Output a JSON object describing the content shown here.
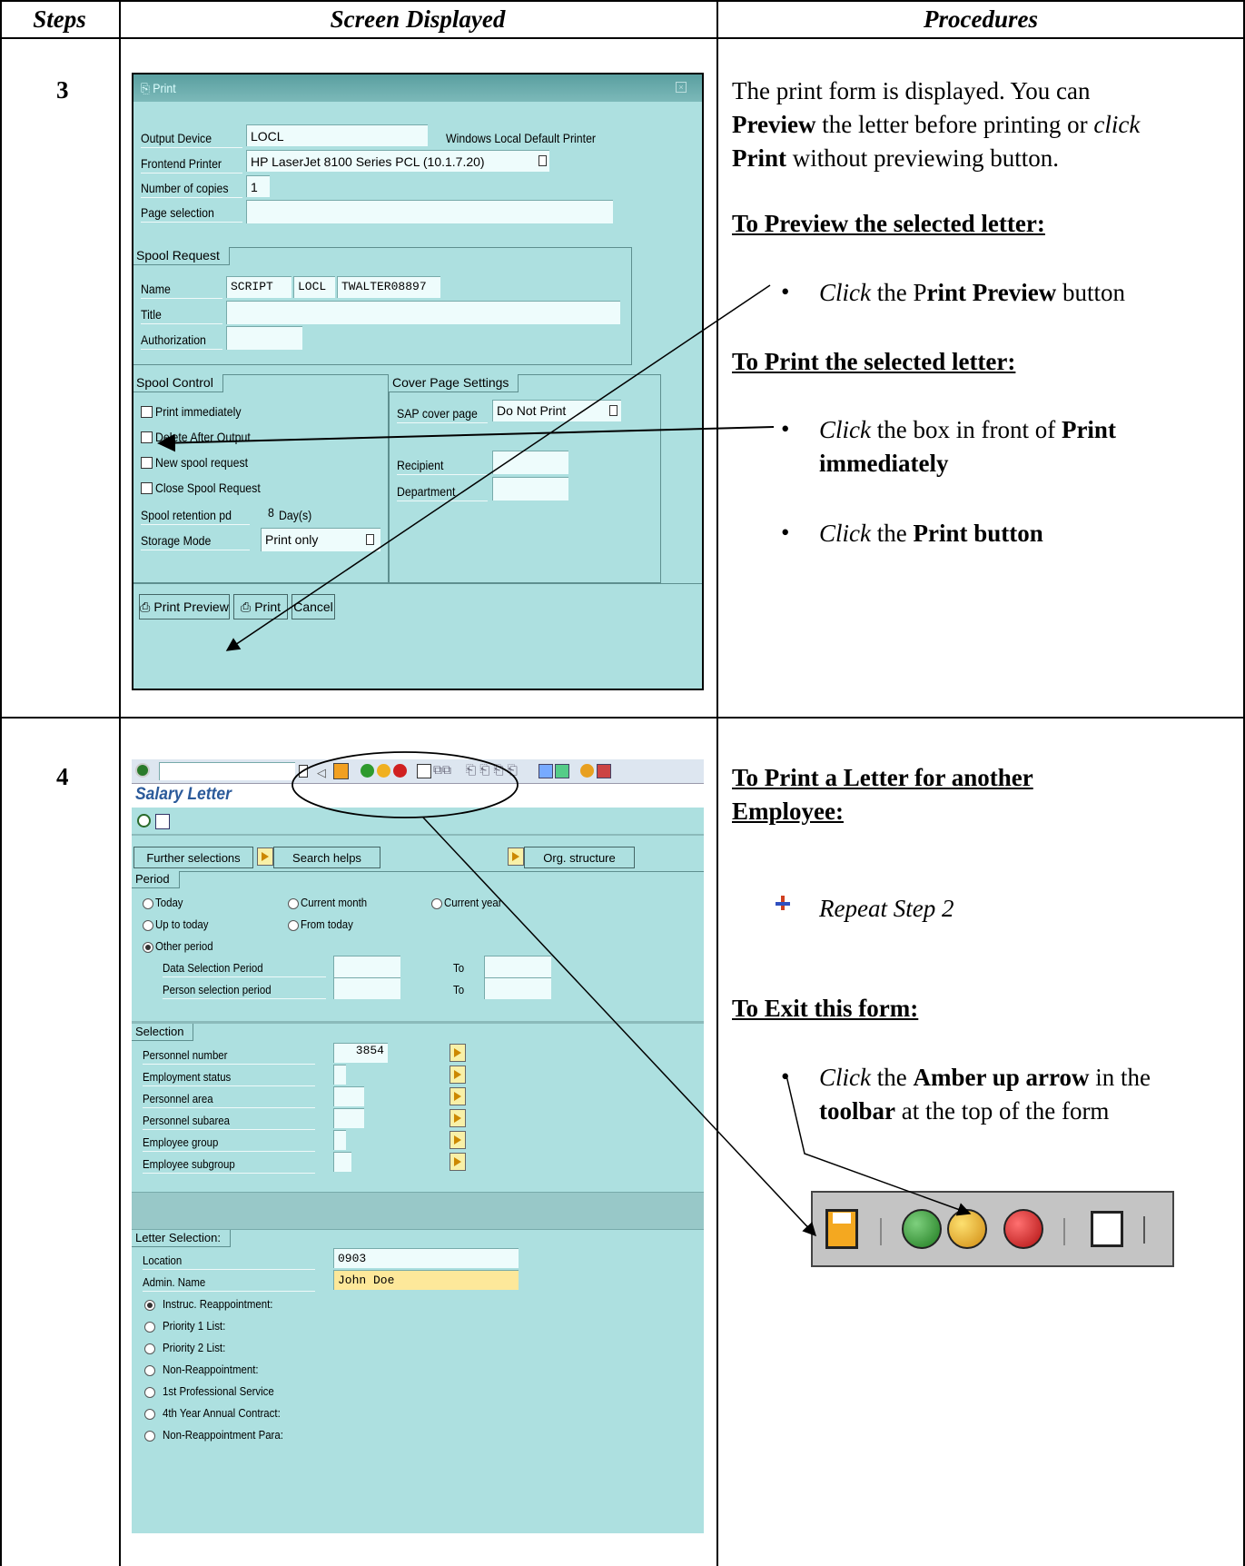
{
  "table": {
    "headers": [
      "Steps",
      "Screen Displayed",
      "Procedures"
    ],
    "steps": [
      "3",
      "4"
    ]
  },
  "print_dialog": {
    "title": "Print",
    "output_device": {
      "label": "Output Device",
      "value": "LOCL",
      "note": "Windows Local Default Printer"
    },
    "frontend_printer": {
      "label": "Frontend Printer",
      "value": "HP LaserJet 8100 Series PCL (10.1.7.20)"
    },
    "copies": {
      "label": "Number of copies",
      "value": "1"
    },
    "page_selection": {
      "label": "Page selection",
      "value": ""
    },
    "spool_request": {
      "group": "Spool Request",
      "name": {
        "label": "Name",
        "v1": "SCRIPT",
        "v2": "LOCL",
        "v3": "TWALTER08897"
      },
      "title": {
        "label": "Title",
        "value": ""
      },
      "authorization": {
        "label": "Authorization",
        "value": ""
      }
    },
    "spool_control": {
      "group": "Spool Control",
      "print_immediately": "Print immediately",
      "delete_after": "Delete After Output",
      "new_spool": "New spool request",
      "close_spool": "Close Spool Request",
      "retention": {
        "label": "Spool retention pd",
        "value": "8",
        "unit": "Day(s)"
      },
      "storage": {
        "label": "Storage Mode",
        "value": "Print only"
      }
    },
    "cover_page": {
      "group": "Cover Page Settings",
      "sap_cover": {
        "label": "SAP cover page",
        "value": "Do Not Print"
      },
      "recipient": "Recipient",
      "department": "Department"
    },
    "buttons": {
      "preview": "Print Preview",
      "print": "Print",
      "cancel": "Cancel"
    }
  },
  "salary_window": {
    "title": "Salary Letter",
    "buttons": {
      "further": "Further selections",
      "search": "Search helps",
      "org": "Org. structure"
    },
    "period": {
      "group": "Period",
      "today": "Today",
      "current_month": "Current month",
      "current_year": "Current year",
      "up_to_today": "Up to today",
      "from_today": "From today",
      "other": "Other period",
      "data_sel": "Data Selection Period",
      "person_sel": "Person selection period",
      "to": "To"
    },
    "selection": {
      "group": "Selection",
      "personnel_number": {
        "label": "Personnel number",
        "value": "3854"
      },
      "employment_status": "Employment status",
      "personnel_area": "Personnel area",
      "personnel_subarea": "Personnel subarea",
      "employee_group": "Employee group",
      "employee_subgroup": "Employee subgroup"
    },
    "letter": {
      "group": "Letter Selection:",
      "location": {
        "label": "Location",
        "value": "0903"
      },
      "admin": {
        "label": "Admin. Name",
        "value": "John Doe"
      },
      "options": [
        "Instruc. Reappointment:",
        "Priority 1 List:",
        "Priority 2 List:",
        "Non-Reappointment:",
        "1st Professional Service",
        "4th Year Annual Contract:",
        "Non-Reappointment Para:"
      ]
    }
  },
  "procedures": {
    "step3": {
      "intro_1": "The print form is displayed. You can",
      "intro_2a": "Preview",
      "intro_2b": " the letter before printing or ",
      "intro_2c": "click",
      "intro_3a": "Print",
      "intro_3b": " without previewing button.",
      "heading_preview": "To  Preview the selected letter:",
      "b1_click": "Click",
      "b1_rest": " the P",
      "b1_bold": "rint Preview",
      "b1_end": " button",
      "heading_print": "To Print the selected letter:",
      "b2_click": "Click",
      "b2_rest": " the box in front of ",
      "b2_bold1": "Print",
      "b2_bold2": "immediately",
      "b3_click": "Click",
      "b3_rest": " the ",
      "b3_bold": "Print button"
    },
    "step4": {
      "heading_another_1": "To Print a Letter for another",
      "heading_another_2": "Employee:",
      "repeat": "Repeat Step 2",
      "heading_exit": "To Exit this form:",
      "b_click": "Click",
      "b_the": " the ",
      "b_bold1": "Amber up arrow",
      "b_in": " in the",
      "b_bold2": "toolbar",
      "b_end": " at the top of the form"
    }
  }
}
